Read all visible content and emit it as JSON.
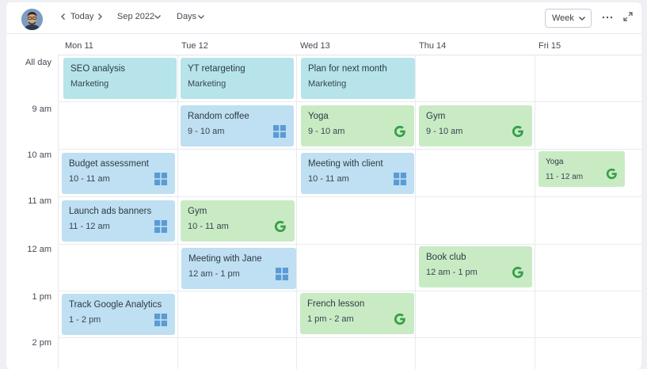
{
  "toolbar": {
    "today_label": "Today",
    "month_label": "Sep 2022",
    "range_label": "Days",
    "view_label": "Week"
  },
  "days": [
    "Mon 11",
    "Tue 12",
    "Wed 13",
    "Thu 14",
    "Fri 15"
  ],
  "times": [
    "All day",
    "9 am",
    "10 am",
    "11 am",
    "12 am",
    "1 pm",
    "2 pm"
  ],
  "events": [
    {
      "title": "SEO analysis",
      "time": "Marketing",
      "color": "#b6e4ea",
      "icon": "none"
    },
    {
      "title": "YT retargeting",
      "time": "Marketing",
      "color": "#b6e4ea",
      "icon": "none"
    },
    {
      "title": "Plan for next month",
      "time": "Marketing",
      "color": "#b6e4ea",
      "icon": "none"
    },
    {
      "title": "Random coffee",
      "time": "9 - 10 am",
      "color": "#bfdff2",
      "icon": "windows-icon"
    },
    {
      "title": "Yoga",
      "time": "9 - 10 am",
      "color": "#c9ebc4",
      "icon": "google-icon"
    },
    {
      "title": "Gym",
      "time": "9 - 10 am",
      "color": "#c9ebc4",
      "icon": "google-icon"
    },
    {
      "title": "Budget assessment",
      "time": "10 - 11 am",
      "color": "#bfdff2",
      "icon": "windows-icon"
    },
    {
      "title": "Meeting with client",
      "time": "10 - 11 am",
      "color": "#bfdff2",
      "icon": "windows-icon"
    },
    {
      "title": "Yoga",
      "time": "11 - 12 am",
      "color": "#c9ebc4",
      "icon": "google-icon"
    },
    {
      "title": "Launch ads banners",
      "time": "11 - 12 am",
      "color": "#bfdff2",
      "icon": "windows-icon"
    },
    {
      "title": "Gym",
      "time": "10 - 11 am",
      "color": "#c9ebc4",
      "icon": "google-icon"
    },
    {
      "title": "Meeting with Jane",
      "time": "12 am - 1 pm",
      "color": "#bfdff2",
      "icon": "windows-icon"
    },
    {
      "title": "Book club",
      "time": "12 am - 1 pm",
      "color": "#c9ebc4",
      "icon": "google-icon"
    },
    {
      "title": "Track Google Analytics",
      "time": "1 - 2 pm",
      "color": "#bfdff2",
      "icon": "windows-icon"
    },
    {
      "title": "French lesson",
      "time": "1 pm - 2 am",
      "color": "#c9ebc4",
      "icon": "google-icon"
    }
  ]
}
